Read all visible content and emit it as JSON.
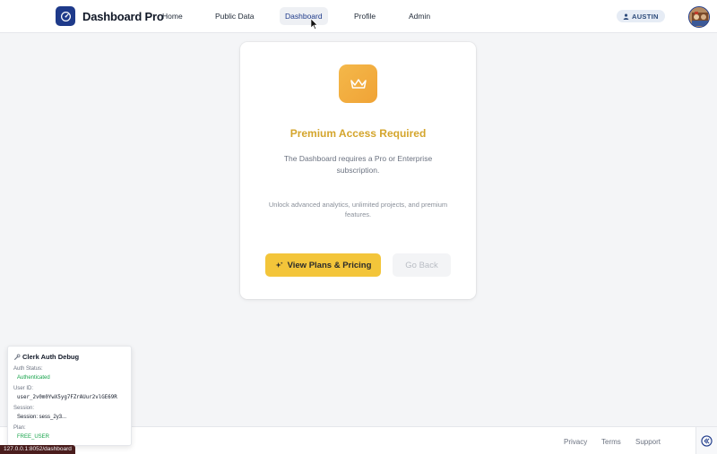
{
  "header": {
    "brand": "Dashboard Pro",
    "nav": [
      "Home",
      "Public Data",
      "Dashboard",
      "Profile",
      "Admin"
    ],
    "active_nav": "Dashboard",
    "user_label": "AUSTIN"
  },
  "card": {
    "title": "Premium Access Required",
    "description": "The Dashboard requires a Pro or Enterprise subscription.",
    "sub": "Unlock advanced analytics, unlimited projects, and premium features.",
    "primary_button": "View Plans & Pricing",
    "secondary_button": "Go Back"
  },
  "footer": {
    "links": [
      "Privacy",
      "Terms",
      "Support"
    ]
  },
  "debug": {
    "title": "Clerk Auth Debug",
    "auth_status_label": "Auth Status:",
    "auth_status": "Authenticated",
    "user_id_label": "User ID:",
    "user_id": "user_2v0m0YwX5yg7FZrAUur2vlGE69R",
    "session_label": "Session:",
    "session": "Session: sess_2y3...",
    "plan_label": "Plan:",
    "plan": "FREE_USER"
  },
  "status_bar": "127.0.0.1:8052/dashboard",
  "colors": {
    "accent": "#1e3a8a",
    "premium": "#d4a52c",
    "primary_button": "#f3c53a",
    "success": "#16a34a"
  }
}
